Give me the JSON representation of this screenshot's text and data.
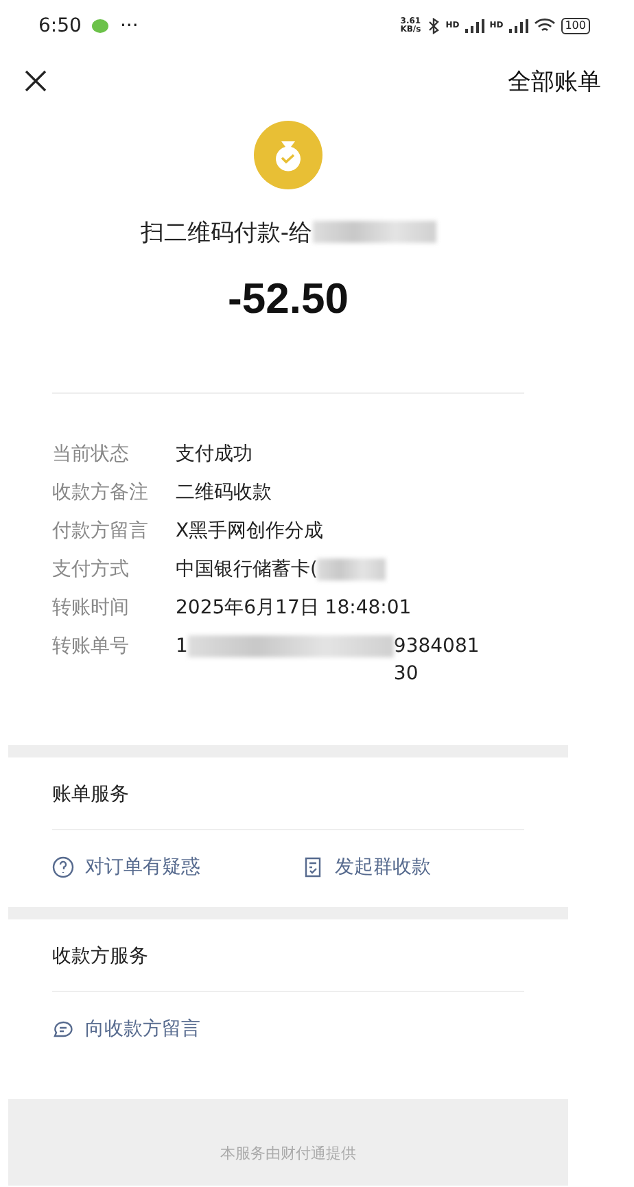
{
  "status_bar": {
    "time": "6:50",
    "more": "···",
    "speed": "3.61",
    "speed_unit": "KB/s",
    "signal_labels": [
      "HD",
      "HD"
    ],
    "battery": "100"
  },
  "nav": {
    "right_link": "全部账单"
  },
  "header": {
    "title": "扫二维码付款-给",
    "title_redacted": true,
    "amount": "-52.50"
  },
  "details": [
    {
      "label": "当前状态",
      "value": "支付成功",
      "redacted": false
    },
    {
      "label": "收款方备注",
      "value": "二维码收款",
      "redacted": false
    },
    {
      "label": "付款方留言",
      "value": "X黑手网创作分成",
      "redacted": false
    },
    {
      "label": "支付方式",
      "value": "中国银行储蓄卡(",
      "redacted": true
    },
    {
      "label": "转账时间",
      "value": "2025年6月17日 18:48:01",
      "redacted": false
    },
    {
      "label": "转账单号",
      "value": "1",
      "redacted": true,
      "value_end": "938408130"
    }
  ],
  "sections": [
    {
      "title": "账单服务",
      "actions": [
        {
          "label": "对订单有疑惑",
          "kind": "question"
        },
        {
          "label": "发起群收款",
          "kind": "receipt"
        }
      ]
    },
    {
      "title": "收款方服务",
      "actions": [
        {
          "label": "向收款方留言",
          "kind": "message"
        }
      ]
    }
  ],
  "footer": "本服务由财付通提供"
}
